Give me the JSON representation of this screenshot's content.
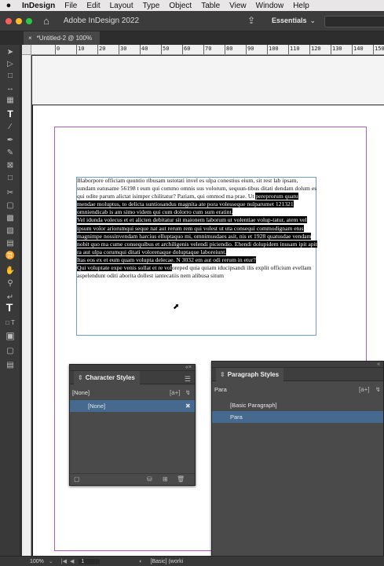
{
  "menubar": {
    "app_name": "InDesign",
    "items": [
      "File",
      "Edit",
      "Layout",
      "Type",
      "Object",
      "Table",
      "View",
      "Window",
      "Help"
    ]
  },
  "appbar": {
    "title": "Adobe InDesign 2022",
    "workspace": "Essentials"
  },
  "document_tab": {
    "label": "*Untitled-2 @ 100%"
  },
  "ruler": {
    "ticks": [
      "0",
      "10",
      "20",
      "30",
      "40",
      "50",
      "60",
      "70",
      "80",
      "90",
      "100",
      "110",
      "120",
      "130",
      "140",
      "150"
    ]
  },
  "story": {
    "p1_a": "Illaborpore officiam quuntio ribusam ustotati invel es ulpa conestius eium, sit rest lab ipsam, sundam eatusame 56198 t eum qui commo omnis sus volorum, sequun-tibus ditati dendam dolum es qui odite parum alictat isimper chilitatur? Pariam, qui ommod ma prae. Ut",
    "p1_hl": "pereprorum quatu mendae moluptus, to delicta suntiosandus magnita ate pora volesseque nulparumet 121321 omniendicab is am simo videm qui cum dolorro cum sum eratint.",
    "p2_hl": "Vel idunda volecus et et alicten debitatur sit maionem laborum ut volentiae volup-tatur, atem vel ipsum volor ariorumqui seque nat aut rerum rem qui volest ut uta consequi commodignam etus magnimpe nossinvendam harcius elluptaquo mi, omnimusdaes asit, nis et 1928 quatusdae vendam nobit quo ma cume consequibus et archiligenis velendi piciendio. Ehendi dolupidem inusam ipit apit ra aut ulpa corumqui ditati volorenaque doluptaque laboreiunt.",
    "p3_hl": "Itas eos ex et eum quam volupta delecae. N 3032 em aut odi rerum in etur?",
    "p4_hl": "Qui voluptate expe venis sollat et re vol",
    "p4_rest": "oreped quia quiam iducipsandi ilis explit officium evellam aspelendunt oditi aborita dollest iantecatiis nem alibusa situm"
  },
  "character_styles": {
    "title": "Character Styles",
    "current": "[None]",
    "items": [
      "[None]"
    ]
  },
  "paragraph_styles": {
    "title": "Paragraph Styles",
    "current": "Para",
    "items": [
      "[Basic Paragraph]",
      "Para"
    ]
  },
  "status": {
    "zoom": "100%",
    "page": "1",
    "style": "[Basic] (worki"
  },
  "colors": {
    "accent_selection": "#46698f",
    "margin_guide": "#b05cc4",
    "frame_edge": "#6e9ccc"
  },
  "icons": {
    "apple": "apple-logo-icon",
    "home": "home-icon",
    "share": "share-icon"
  }
}
